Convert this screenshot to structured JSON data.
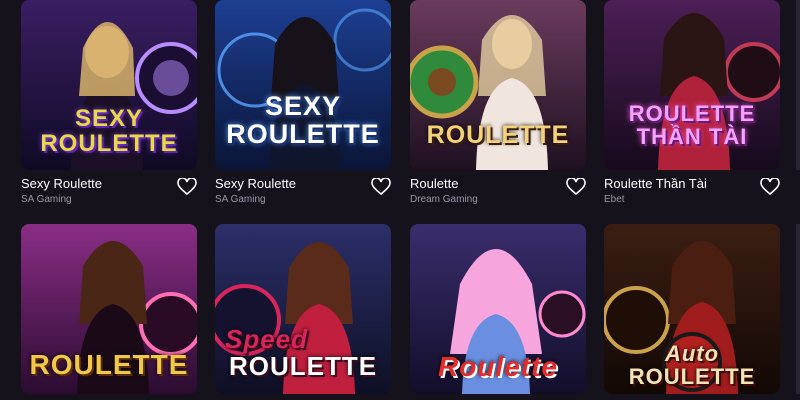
{
  "games": [
    {
      "title": "Sexy Roulette",
      "provider": "SA Gaming",
      "logo_lines": [
        "SEXY",
        "ROULETTE"
      ],
      "colors": {
        "bg1": "#3a1e63",
        "bg2": "#0f0a24",
        "accent": "#b98cff",
        "logo": "#e9d94a"
      }
    },
    {
      "title": "Sexy Roulette",
      "provider": "SA Gaming",
      "logo_lines": [
        "SEXY",
        "ROULETTE"
      ],
      "colors": {
        "bg1": "#1d3f93",
        "bg2": "#0a1436",
        "accent": "#5aa6ff",
        "logo": "#ffffff"
      }
    },
    {
      "title": "Roulette",
      "provider": "Dream Gaming",
      "logo_lines": [
        "ROULETTE",
        ""
      ],
      "colors": {
        "bg1": "#6a3b5e",
        "bg2": "#1f1020",
        "accent": "#2f8a3c",
        "logo": "#f3d27a"
      }
    },
    {
      "title": "Roulette Thần Tài",
      "provider": "Ebet",
      "logo_lines": [
        "ROULETTE",
        "THẦN TÀI"
      ],
      "colors": {
        "bg1": "#4c1f56",
        "bg2": "#160a1c",
        "accent": "#c23a55",
        "logo": "#f5a3ff"
      }
    },
    {
      "title": "",
      "provider": "",
      "logo_lines": [
        "ROULETTE",
        ""
      ],
      "colors": {
        "bg1": "#8a2d86",
        "bg2": "#2b0c30",
        "accent": "#ff6fb2",
        "logo": "#f2c84b"
      }
    },
    {
      "title": "",
      "provider": "",
      "logo_lines": [
        "Speed",
        "ROULETTE"
      ],
      "colors": {
        "bg1": "#2c2f6a",
        "bg2": "#0e0f24",
        "accent": "#d9245c",
        "logo": "#ffffff"
      }
    },
    {
      "title": "",
      "provider": "",
      "logo_lines": [
        "Roulette",
        ""
      ],
      "colors": {
        "bg1": "#3a2d6e",
        "bg2": "#120e2a",
        "accent": "#ff8ad0",
        "logo": "#e32d2d"
      }
    },
    {
      "title": "",
      "provider": "",
      "logo_lines": [
        "Auto",
        "ROULETTE"
      ],
      "colors": {
        "bg1": "#3b1e12",
        "bg2": "#120805",
        "accent": "#b2211f",
        "logo": "#f4e3b5"
      }
    }
  ],
  "icons": {
    "favorite": "heart-icon"
  }
}
